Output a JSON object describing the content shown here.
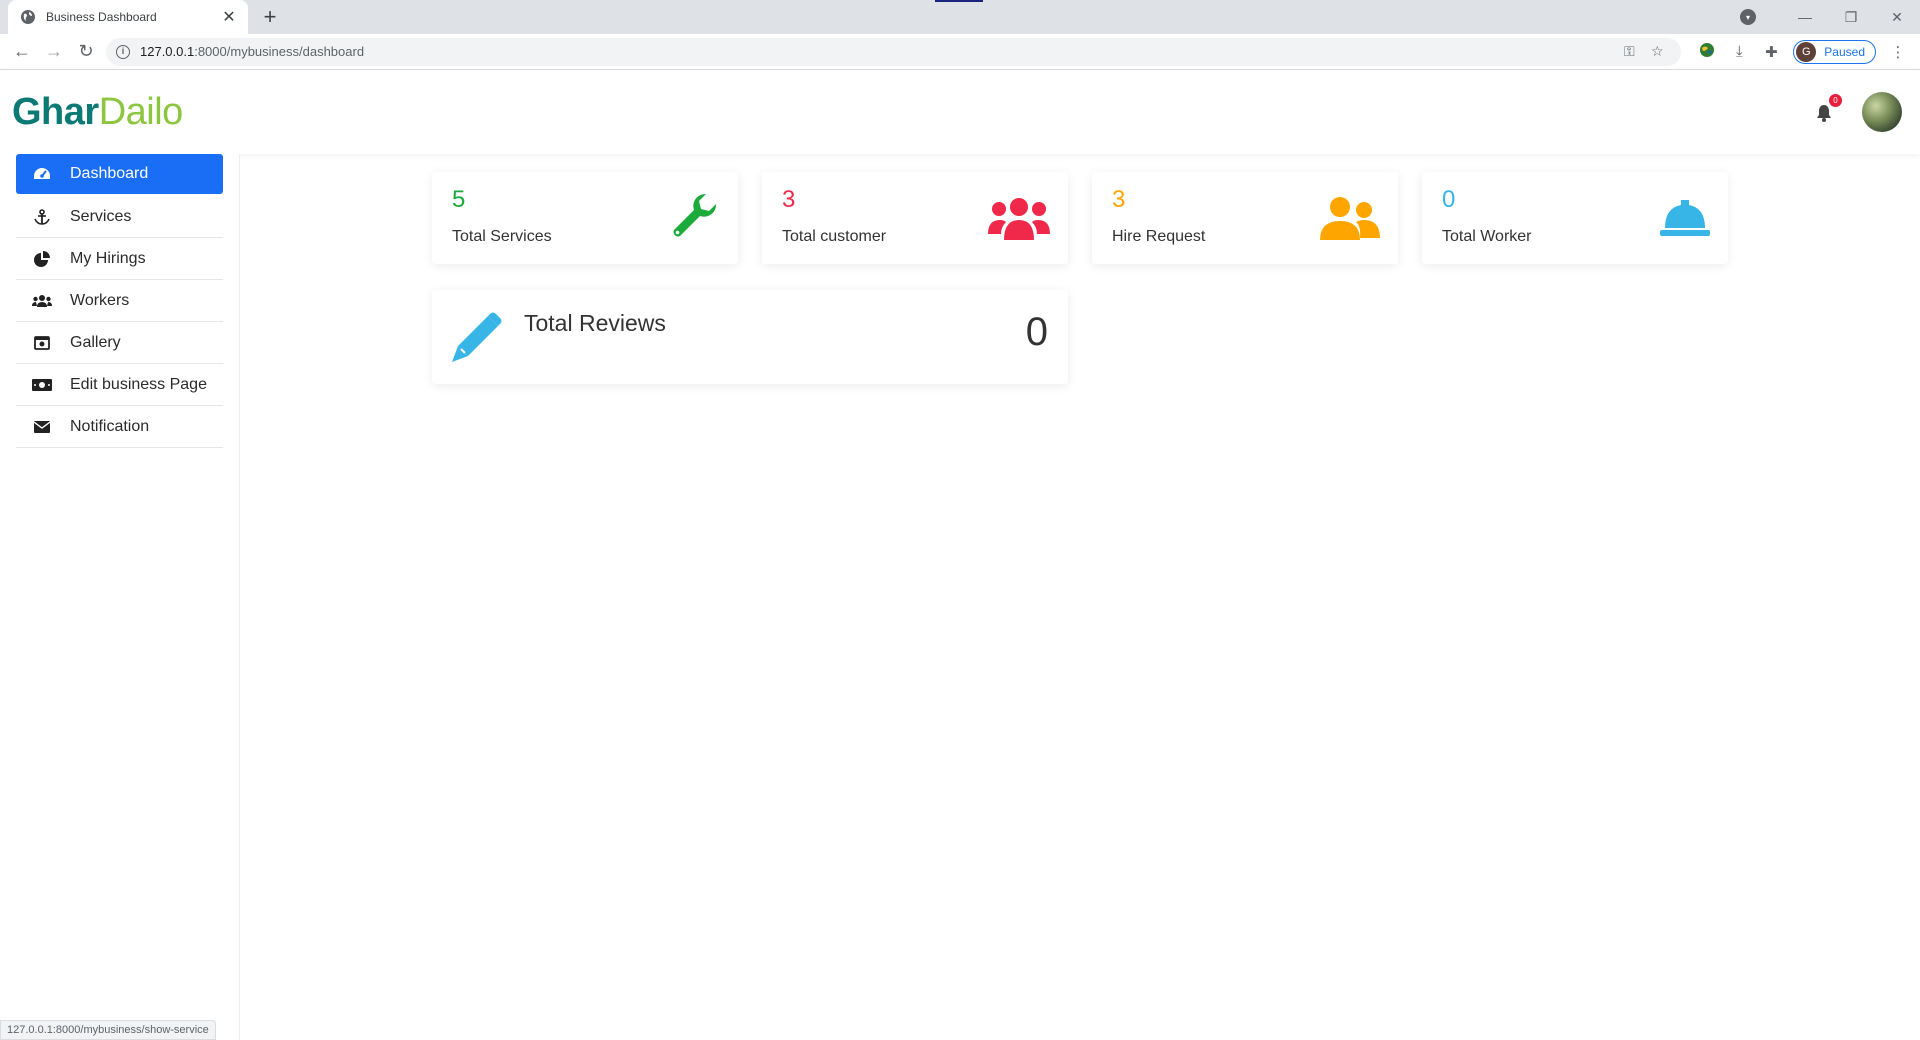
{
  "browser": {
    "tab_title": "Business Dashboard",
    "url_host": "127.0.0.1",
    "url_path": ":8000/mybusiness/dashboard",
    "profile_initial": "G",
    "profile_status": "Paused",
    "status_url": "127.0.0.1:8000/mybusiness/show-service"
  },
  "header": {
    "logo_part1": "Ghar",
    "logo_part2": "Dailo",
    "notification_count": "0"
  },
  "sidebar": {
    "items": [
      {
        "label": "Dashboard",
        "icon": "speedometer-icon",
        "active": true
      },
      {
        "label": "Services",
        "icon": "anchor-icon"
      },
      {
        "label": "My Hirings",
        "icon": "pie-chart-icon"
      },
      {
        "label": "Workers",
        "icon": "users-icon"
      },
      {
        "label": "Gallery",
        "icon": "camera-icon"
      },
      {
        "label": "Edit business Page",
        "icon": "money-bill-icon"
      },
      {
        "label": "Notification",
        "icon": "envelope-icon"
      }
    ]
  },
  "stats": [
    {
      "value": "5",
      "label": "Total Services",
      "color": "#1aab3b",
      "icon": "wrench-icon"
    },
    {
      "value": "3",
      "label": "Total customer",
      "color": "#f0284a",
      "icon": "users-icon"
    },
    {
      "value": "3",
      "label": "Hire Request",
      "color": "#ffa500",
      "icon": "user-friends-icon"
    },
    {
      "value": "0",
      "label": "Total Worker",
      "color": "#36b5e6",
      "icon": "hard-hat-icon"
    }
  ],
  "reviews": {
    "title": "Total Reviews",
    "count": "0",
    "color": "#36b5e6",
    "icon": "pencil-icon"
  }
}
